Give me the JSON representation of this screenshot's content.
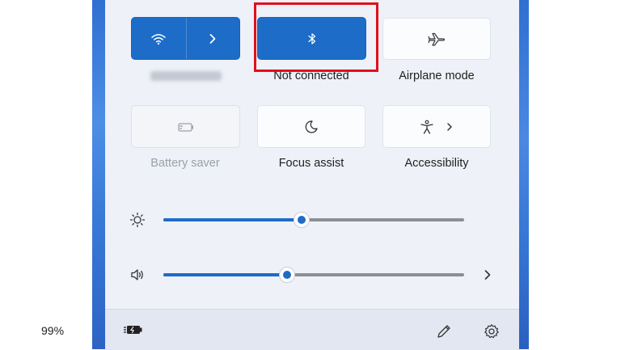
{
  "quick_settings": {
    "tiles": [
      {
        "id": "wifi",
        "label": "",
        "state": "on",
        "icons": [
          "wifi-icon",
          "chevron-right-icon"
        ]
      },
      {
        "id": "bluetooth",
        "label": "Not connected",
        "state": "on",
        "icon": "bluetooth-icon"
      },
      {
        "id": "airplane",
        "label": "Airplane mode",
        "state": "off",
        "icon": "airplane-icon"
      },
      {
        "id": "battery_saver",
        "label": "Battery saver",
        "state": "disabled",
        "icon": "battery-saver-icon"
      },
      {
        "id": "focus_assist",
        "label": "Focus assist",
        "state": "off",
        "icon": "moon-icon"
      },
      {
        "id": "accessibility",
        "label": "Accessibility",
        "state": "off",
        "icons": [
          "accessibility-icon",
          "chevron-right-icon"
        ]
      }
    ],
    "brightness": {
      "icon": "brightness-icon",
      "level_percent": 46
    },
    "volume": {
      "icon": "speaker-icon",
      "level_percent": 41
    },
    "footer": {
      "battery_text": "99%",
      "icons": [
        "battery-charging-icon",
        "edit-pencil-icon",
        "settings-gear-icon"
      ]
    }
  },
  "colors": {
    "accent": "#1d6cc8",
    "highlight": "#e2101b",
    "panel": "#eef1f8"
  }
}
